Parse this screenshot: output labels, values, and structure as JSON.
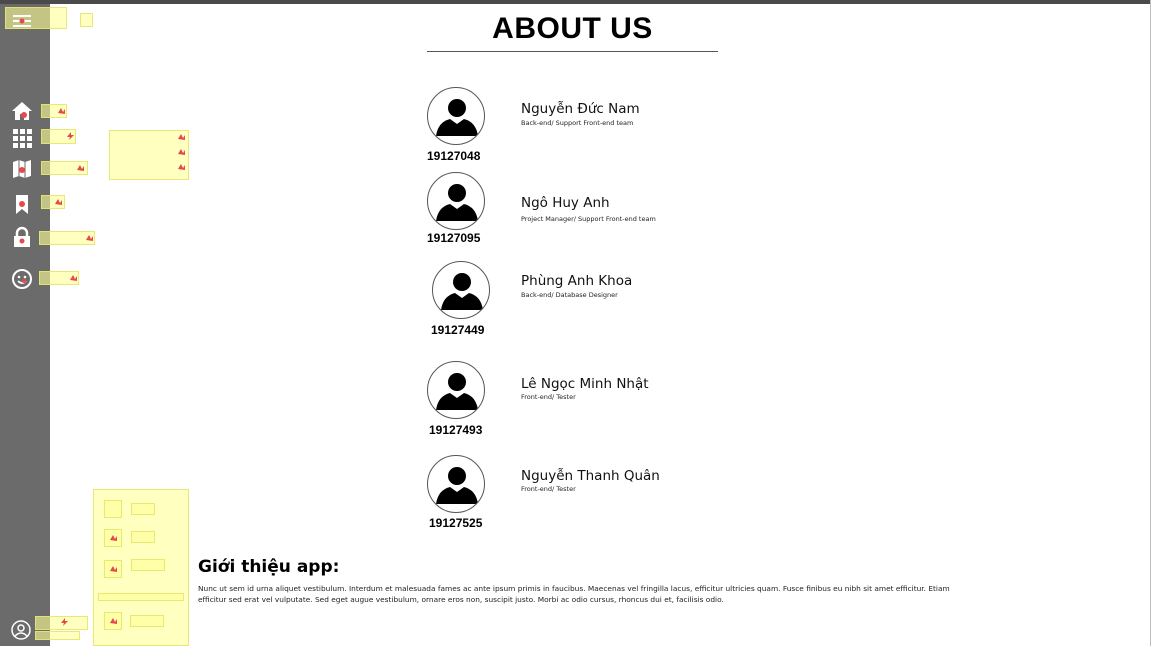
{
  "page": {
    "title": "ABOUT US"
  },
  "sidebar": {
    "menu_icon": "hamburger-menu-icon",
    "items": [
      {
        "name": "home",
        "icon": "home-icon"
      },
      {
        "name": "apps",
        "icon": "grid-icon"
      },
      {
        "name": "map",
        "icon": "map-icon"
      },
      {
        "name": "bookmark",
        "icon": "bookmark-icon"
      },
      {
        "name": "lock",
        "icon": "lock-icon"
      },
      {
        "name": "face",
        "icon": "emoji-icon"
      }
    ],
    "account_icon": "user-icon"
  },
  "members": [
    {
      "name": "Nguyễn Đức Nam",
      "role": "Back-end/ Support Front-end team",
      "id": "19127048"
    },
    {
      "name": "Ngô Huy Anh",
      "role": "Project Manager/ Support Front-end team",
      "id": "19127095"
    },
    {
      "name": "Phùng Anh Khoa",
      "role": "Back-end/ Database Designer",
      "id": "19127449"
    },
    {
      "name": "Lê Ngọc Minh Nhật",
      "role": "Front-end/ Tester",
      "id": "19127493"
    },
    {
      "name": "Nguyễn Thanh Quân",
      "role": "Front-end/ Tester",
      "id": "19127525"
    }
  ],
  "app_intro": {
    "heading": "Giới thiệu app:",
    "text": "Nunc ut sem id urna aliquet vestibulum. Interdum et malesuada fames ac ante ipsum primis in faucibus. Maecenas vel fringilla lacus, efficitur ultricies quam. Fusce finibus eu nibh sit amet efficitur. Etiam efficitur sed erat vel vulputate. Sed eget augue vestibulum, ornare eros non, suscipit justo. Morbi ac odio cursus, rhoncus dui et, facilisis odio."
  },
  "colors": {
    "sidebar": "#6b6b6b",
    "topbar": "#4a4a4a",
    "highlight": "#ffff96",
    "marker": "#e8474c"
  }
}
